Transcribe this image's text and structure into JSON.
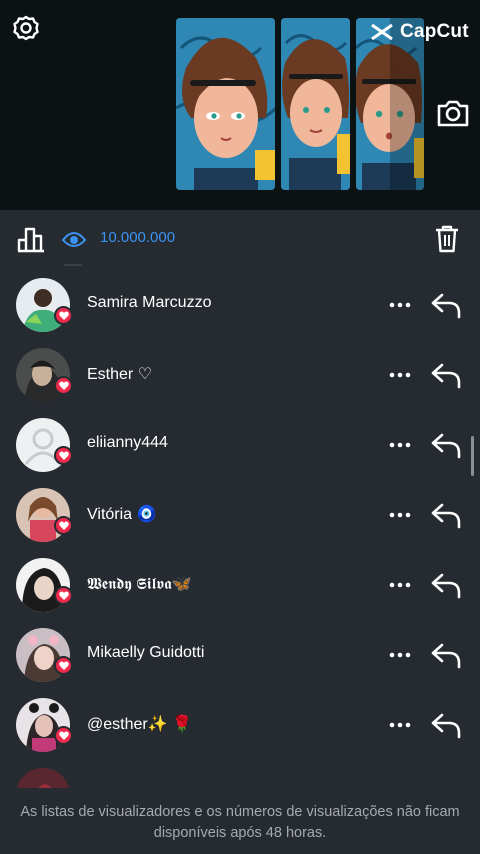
{
  "watermark": {
    "brand": "CapCut"
  },
  "toolbar": {
    "views": "10.000.000"
  },
  "viewers": [
    {
      "name": "Samira Marcuzzo"
    },
    {
      "name": "Esther ♡"
    },
    {
      "name": "eliianny444"
    },
    {
      "name": "Vitória 🧿"
    },
    {
      "name": "𝖂𝖊𝖓𝖉𝖞 𝕾𝖎𝖑𝖛𝖆🦋"
    },
    {
      "name": "Mikaelly Guidotti"
    },
    {
      "name": "@esther✨ 🌹"
    }
  ],
  "footer": {
    "notice": "As listas de visualizadores e os números de visualizações não ficam disponíveis após 48 horas."
  },
  "colors": {
    "accent": "#3b93f0",
    "heart": "#ee2a4d",
    "background": "#262b31"
  }
}
